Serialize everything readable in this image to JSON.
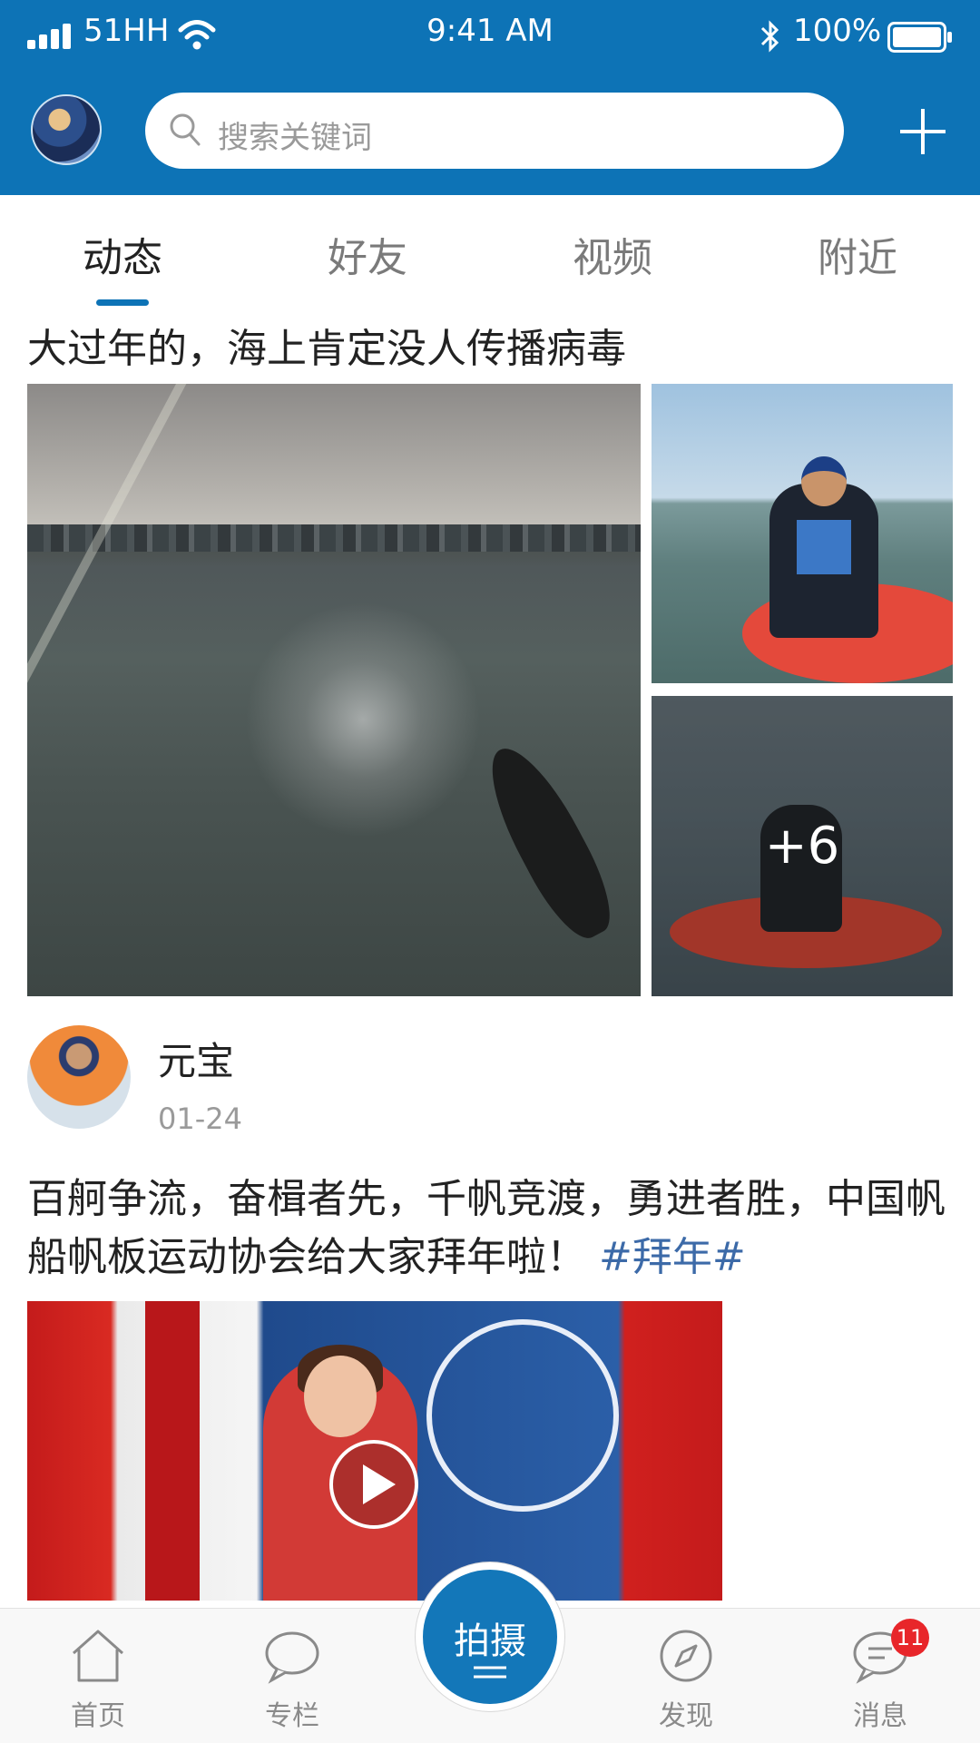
{
  "status_bar": {
    "carrier": "51HH",
    "time": "9:41 AM",
    "battery": "100%"
  },
  "header": {
    "search_placeholder": "搜索关键词",
    "brand_color": "#0d73b6"
  },
  "tabs": [
    {
      "label": "动态",
      "active": true
    },
    {
      "label": "好友",
      "active": false
    },
    {
      "label": "视频",
      "active": false
    },
    {
      "label": "附近",
      "active": false
    }
  ],
  "posts": [
    {
      "title": "大过年的，海上肯定没人传播病毒",
      "more_photos_count": "+6"
    },
    {
      "author": "元宝",
      "date": "01-24",
      "text": "百舸争流，奋楫者先，千帆竞渡，勇进者胜，中国帆船帆板运动协会给大家拜年啦！",
      "tag": "#拜年#"
    }
  ],
  "bottom_nav": {
    "home": "首页",
    "column": "专栏",
    "shoot": "拍摄",
    "discover": "发现",
    "messages": "消息",
    "messages_badge": "11",
    "badge_color": "#e8262a"
  }
}
